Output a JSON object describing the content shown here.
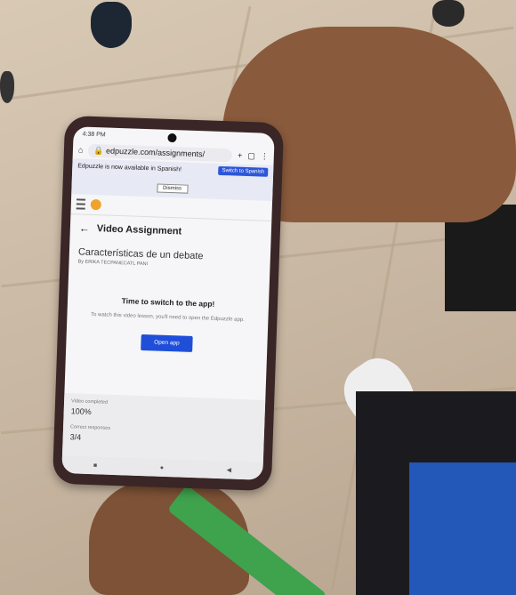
{
  "status_bar": {
    "time": "4:38 PM",
    "icons_right": ""
  },
  "browser": {
    "url": "edpuzzle.com/assignments/"
  },
  "banner": {
    "message": "Edpuzzle is now available in Spanish!",
    "switch_label": "Switch to Spanish",
    "dismiss_label": "Dismiss"
  },
  "header": {
    "title": "Video Assignment"
  },
  "lesson": {
    "title": "Características de un debate",
    "author": "By ERIKA TECPANECATL PANI"
  },
  "prompt": {
    "title": "Time to switch to the app!",
    "description": "To watch this video lesson, you'll need to open the Edpuzzle app.",
    "button_label": "Open app"
  },
  "stats": {
    "completed_label": "Video completed",
    "completed_value": "100%",
    "responses_label": "Correct responses",
    "responses_value": "3/4"
  },
  "nav": {
    "square": "■",
    "circle": "●",
    "back": "◀"
  },
  "icons": [
    "home-icon",
    "lock-icon",
    "plus-icon",
    "tabs-icon",
    "more-icon",
    "back-arrow-icon",
    "hamburger-icon",
    "edpuzzle-logo-icon"
  ],
  "colors": {
    "accent": "#1f4fd9",
    "banner_bg": "#e7e9f4"
  }
}
